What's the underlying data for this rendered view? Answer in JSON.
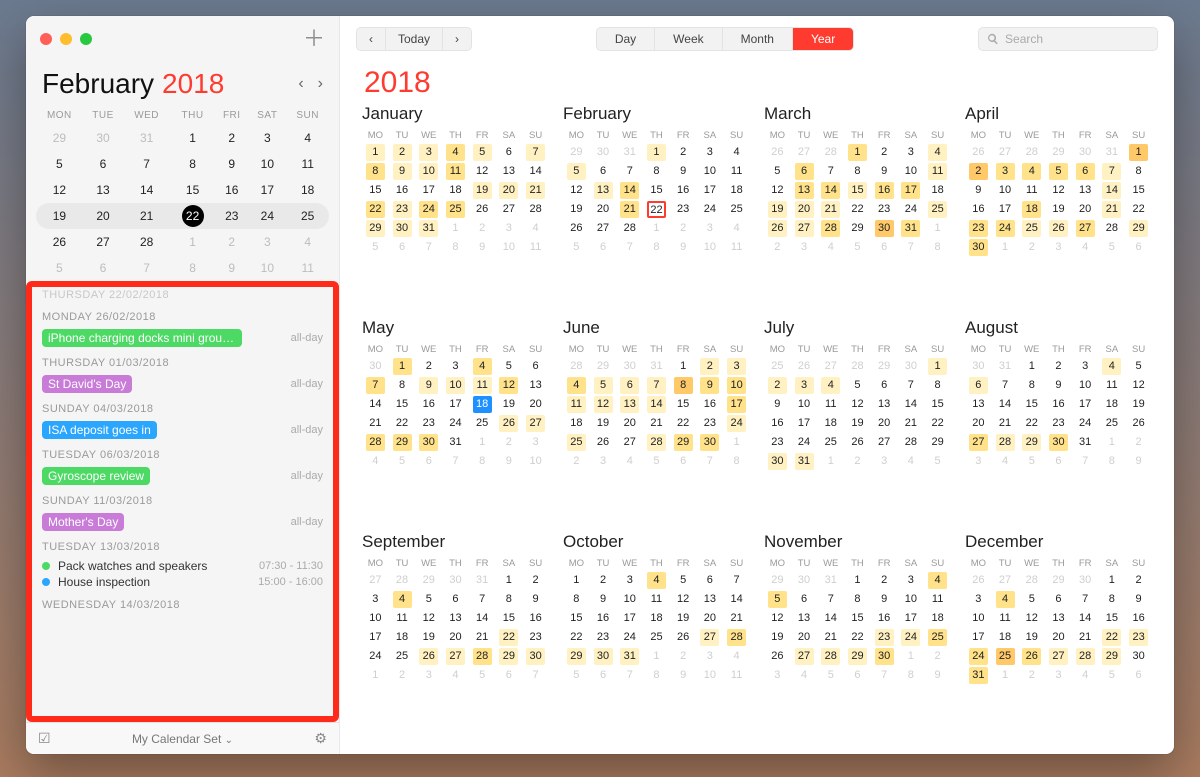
{
  "sidebar": {
    "month": "February",
    "year": "2018",
    "weekday_short": [
      "MON",
      "TUE",
      "WED",
      "THU",
      "FRI",
      "SAT",
      "SUN"
    ],
    "mini_weeks": [
      {
        "cw": false,
        "days": [
          {
            "n": "29",
            "dim": true
          },
          {
            "n": "30",
            "dim": true
          },
          {
            "n": "31",
            "dim": true
          },
          {
            "n": "1"
          },
          {
            "n": "2"
          },
          {
            "n": "3"
          },
          {
            "n": "4"
          }
        ]
      },
      {
        "cw": false,
        "days": [
          {
            "n": "5"
          },
          {
            "n": "6"
          },
          {
            "n": "7"
          },
          {
            "n": "8"
          },
          {
            "n": "9"
          },
          {
            "n": "10"
          },
          {
            "n": "11"
          }
        ]
      },
      {
        "cw": false,
        "days": [
          {
            "n": "12"
          },
          {
            "n": "13"
          },
          {
            "n": "14"
          },
          {
            "n": "15"
          },
          {
            "n": "16"
          },
          {
            "n": "17"
          },
          {
            "n": "18"
          }
        ]
      },
      {
        "cw": true,
        "days": [
          {
            "n": "19"
          },
          {
            "n": "20"
          },
          {
            "n": "21"
          },
          {
            "n": "22",
            "today": true
          },
          {
            "n": "23"
          },
          {
            "n": "24"
          },
          {
            "n": "25"
          }
        ]
      },
      {
        "cw": false,
        "days": [
          {
            "n": "26"
          },
          {
            "n": "27"
          },
          {
            "n": "28"
          },
          {
            "n": "1",
            "dim": true
          },
          {
            "n": "2",
            "dim": true
          },
          {
            "n": "3",
            "dim": true
          },
          {
            "n": "4",
            "dim": true
          }
        ]
      },
      {
        "cw": false,
        "days": [
          {
            "n": "5",
            "dim": true
          },
          {
            "n": "6",
            "dim": true
          },
          {
            "n": "7",
            "dim": true
          },
          {
            "n": "8",
            "dim": true
          },
          {
            "n": "9",
            "dim": true
          },
          {
            "n": "10",
            "dim": true
          },
          {
            "n": "11",
            "dim": true
          }
        ]
      }
    ],
    "events": [
      {
        "header": "THURSDAY 22/02/2018",
        "dimmed": true
      },
      {
        "header": "MONDAY 26/02/2018",
        "items": [
          {
            "kind": "pill",
            "color": "green",
            "text": "iPhone charging docks mini group…",
            "time": "all-day"
          }
        ]
      },
      {
        "header": "THURSDAY 01/03/2018",
        "items": [
          {
            "kind": "pill",
            "color": "purple",
            "text": "St David's Day",
            "time": "all-day"
          }
        ]
      },
      {
        "header": "SUNDAY 04/03/2018",
        "items": [
          {
            "kind": "pill",
            "color": "blue",
            "text": "ISA deposit goes in",
            "time": "all-day"
          }
        ]
      },
      {
        "header": "TUESDAY 06/03/2018",
        "items": [
          {
            "kind": "pill",
            "color": "green",
            "text": "Gyroscope review",
            "time": "all-day"
          }
        ]
      },
      {
        "header": "SUNDAY 11/03/2018",
        "items": [
          {
            "kind": "pill",
            "color": "purple",
            "text": "Mother's Day",
            "time": "all-day"
          }
        ]
      },
      {
        "header": "TUESDAY 13/03/2018",
        "items": [
          {
            "kind": "bullet",
            "color": "green",
            "text": "Pack watches and speakers",
            "time": "07:30 - 11:30"
          },
          {
            "kind": "bullet",
            "color": "blue",
            "text": "House inspection",
            "time": "15:00 - 16:00"
          }
        ]
      },
      {
        "header": "WEDNESDAY 14/03/2018"
      }
    ],
    "bottombar": {
      "set": "My Calendar Set"
    }
  },
  "toolbar": {
    "today": "Today",
    "views": [
      "Day",
      "Week",
      "Month",
      "Year"
    ],
    "active": "Year",
    "search_ph": "Search"
  },
  "year": {
    "title": "2018",
    "wk": [
      "MO",
      "TU",
      "WE",
      "TH",
      "FR",
      "SA",
      "SU"
    ],
    "months": [
      {
        "name": "January",
        "start": 1,
        "len": 31,
        "prev": 31,
        "heat": {
          "1": 1,
          "2": 1,
          "3": 1,
          "4": 2,
          "5": 1,
          "7": 1,
          "8": 2,
          "9": 1,
          "10": 1,
          "11": 2,
          "19": 1,
          "20": 1,
          "21": 1,
          "22": 2,
          "23": 1,
          "24": 2,
          "25": 2,
          "29": 1,
          "30": 1,
          "31": 1
        }
      },
      {
        "name": "February",
        "start": 4,
        "len": 28,
        "prev": 31,
        "today": 22,
        "heat": {
          "1": 1,
          "5": 1,
          "13": 1,
          "14": 2,
          "21": 2,
          "22": 0
        }
      },
      {
        "name": "March",
        "start": 4,
        "len": 31,
        "prev": 28,
        "heat": {
          "1": 2,
          "4": 1,
          "6": 2,
          "11": 1,
          "13": 2,
          "14": 2,
          "15": 1,
          "16": 2,
          "17": 2,
          "19": 1,
          "20": 1,
          "21": 1,
          "25": 1,
          "26": 1,
          "27": 1,
          "28": 2,
          "30": 3,
          "31": 2
        }
      },
      {
        "name": "April",
        "start": 7,
        "len": 30,
        "prev": 31,
        "heat": {
          "1": 3,
          "2": 3,
          "3": 2,
          "4": 2,
          "5": 2,
          "6": 2,
          "7": 1,
          "14": 1,
          "18": 2,
          "21": 1,
          "23": 2,
          "24": 2,
          "25": 1,
          "26": 1,
          "27": 2,
          "29": 1,
          "30": 2
        }
      },
      {
        "name": "May",
        "start": 2,
        "len": 31,
        "prev": 30,
        "bluebox": 18,
        "heat": {
          "1": 2,
          "4": 2,
          "7": 2,
          "9": 1,
          "10": 1,
          "11": 1,
          "12": 2,
          "26": 1,
          "27": 1,
          "28": 2,
          "29": 2,
          "30": 2
        }
      },
      {
        "name": "June",
        "start": 5,
        "len": 30,
        "prev": 31,
        "heat": {
          "2": 1,
          "3": 1,
          "4": 2,
          "5": 1,
          "6": 1,
          "7": 1,
          "8": 3,
          "9": 2,
          "10": 2,
          "11": 1,
          "12": 1,
          "13": 1,
          "14": 1,
          "17": 2,
          "24": 1,
          "25": 1,
          "28": 1,
          "29": 2,
          "30": 2
        }
      },
      {
        "name": "July",
        "start": 7,
        "len": 31,
        "prev": 30,
        "heat": {
          "1": 1,
          "2": 1,
          "3": 1,
          "4": 1,
          "30": 1,
          "31": 1
        }
      },
      {
        "name": "August",
        "start": 3,
        "len": 31,
        "prev": 31,
        "heat": {
          "4": 1,
          "6": 1,
          "27": 2,
          "28": 1,
          "29": 1,
          "30": 2
        }
      },
      {
        "name": "September",
        "start": 6,
        "len": 30,
        "prev": 31,
        "heat": {
          "4": 2,
          "22": 1,
          "26": 1,
          "27": 1,
          "28": 2,
          "29": 1,
          "30": 1
        }
      },
      {
        "name": "October",
        "start": 1,
        "len": 31,
        "prev": 30,
        "heat": {
          "4": 2,
          "27": 1,
          "28": 2,
          "29": 1,
          "30": 1,
          "31": 1
        }
      },
      {
        "name": "November",
        "start": 4,
        "len": 30,
        "prev": 31,
        "heat": {
          "4": 2,
          "5": 2,
          "23": 1,
          "24": 1,
          "25": 2,
          "27": 1,
          "28": 1,
          "29": 1,
          "30": 2
        }
      },
      {
        "name": "December",
        "start": 6,
        "len": 31,
        "prev": 30,
        "heat": {
          "4": 2,
          "22": 1,
          "23": 1,
          "24": 2,
          "25": 3,
          "26": 2,
          "27": 1,
          "28": 1,
          "29": 1,
          "31": 2
        }
      }
    ]
  }
}
